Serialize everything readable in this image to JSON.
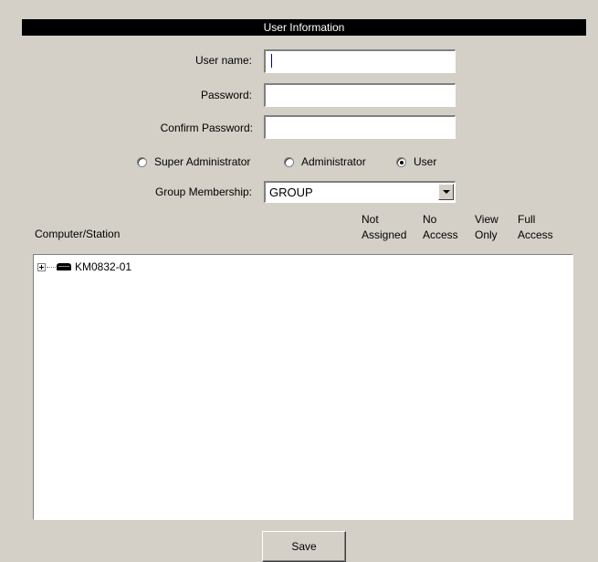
{
  "panel": {
    "title": "User Information"
  },
  "form": {
    "username": {
      "label": "User name:",
      "value": ""
    },
    "password": {
      "label": "Password:",
      "value": ""
    },
    "confirm_password": {
      "label": "Confirm Password:",
      "value": ""
    }
  },
  "roles": {
    "options": [
      {
        "label": "Super Administrator",
        "checked": false
      },
      {
        "label": "Administrator",
        "checked": false
      },
      {
        "label": "User",
        "checked": true
      }
    ]
  },
  "group": {
    "label": "Group Membership:",
    "selected": "GROUP"
  },
  "columns": {
    "station": "Computer/Station",
    "not_assigned": [
      "Not",
      "Assigned"
    ],
    "no_access": [
      "No",
      "Access"
    ],
    "view_only": [
      "View",
      "Only"
    ],
    "full_access": [
      "Full",
      "Access"
    ]
  },
  "tree": {
    "items": [
      {
        "label": "KM0832-01",
        "icon": "kvm-switch-icon"
      }
    ]
  },
  "actions": {
    "save_label": "Save"
  }
}
